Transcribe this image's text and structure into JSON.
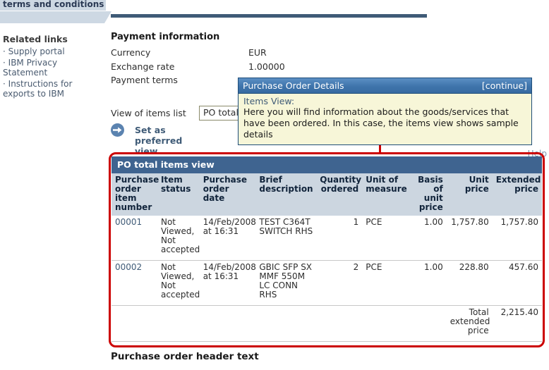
{
  "sidebar": {
    "breadcrumb_tab": "terms and conditions",
    "related_links_title": "Related links",
    "links": [
      {
        "label": "Supply portal"
      },
      {
        "label": "IBM Privacy Statement"
      },
      {
        "label": "Instructions for exports to IBM"
      }
    ]
  },
  "payment": {
    "heading": "Payment information",
    "rows": [
      {
        "label": "Currency",
        "value": "EUR"
      },
      {
        "label": "Exchange rate",
        "value": "1.00000"
      },
      {
        "label": "Payment terms",
        "value": ""
      }
    ]
  },
  "view_controls": {
    "label": "View of items list",
    "selected_option": "PO total",
    "preferred_view_label": "Set as preferred view"
  },
  "tooltip": {
    "title": "Purchase Order Details",
    "continue_label": "[continue]",
    "subtitle": "Items View:",
    "text": "Here you will find information about the goods/services that have been ordered. In this case, the items view shows sample details"
  },
  "help_link": "Help",
  "items_table": {
    "title": "PO total items view",
    "columns": [
      "Purchase order item number",
      "Item status",
      "Purchase order date",
      "Brief description",
      "Quantity ordered",
      "Unit of measure",
      "Basis of unit price",
      "Unit price",
      "Extended price"
    ],
    "rows": [
      {
        "item_number": "00001",
        "item_status": "Not Viewed, Not accepted",
        "order_date": "14/Feb/2008 at 16:31",
        "description": "TEST C364T SWITCH RHS",
        "quantity": "1",
        "uom": "PCE",
        "basis": "1.00",
        "unit_price": "1,757.80",
        "extended_price": "1,757.80"
      },
      {
        "item_number": "00002",
        "item_status": "Not Viewed, Not accepted",
        "order_date": "14/Feb/2008 at 16:31",
        "description": "GBIC SFP SX MMF 550M LC CONN RHS",
        "quantity": "2",
        "uom": "PCE",
        "basis": "1.00",
        "unit_price": "228.80",
        "extended_price": "457.60"
      }
    ],
    "total_label": "Total extended price",
    "total_value": "2,215.40"
  },
  "footer": {
    "heading": "Purchase order header text"
  },
  "colors": {
    "header_bar": "#3f5b77",
    "table_header_band": "#3f6490",
    "table_column_header": "#ccd6e0",
    "sidebar_tab": "#cdd8e3",
    "annotation_red": "#cc0000",
    "tooltip_body": "#f7f6d8",
    "tooltip_title": "#3f74ab",
    "link_blue": "#3f5b77"
  }
}
